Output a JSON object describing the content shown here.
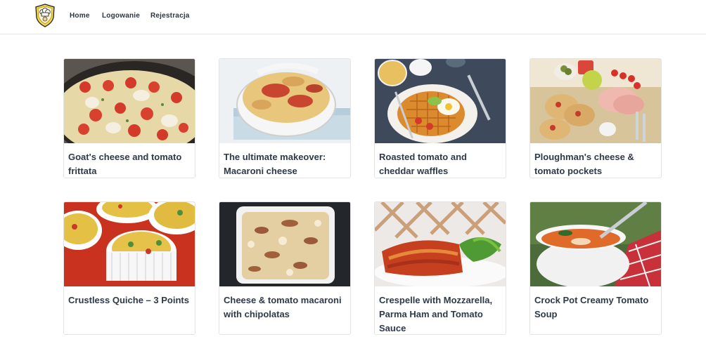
{
  "nav": {
    "logo_icon": "chef-hat-badge-icon",
    "links": [
      "Home",
      "Logowanie",
      "Rejestracja"
    ]
  },
  "recipes": [
    {
      "title": "Goat's cheese and tomato frittata",
      "image": "frittata-photo"
    },
    {
      "title": "The ultimate makeover: Macaroni cheese",
      "image": "macaroni-cheese-photo"
    },
    {
      "title": "Roasted tomato and cheddar waffles",
      "image": "waffles-photo"
    },
    {
      "title": "Ploughman's cheese & tomato pockets",
      "image": "ploughmans-pockets-photo"
    },
    {
      "title": "Crustless Quiche – 3 Points",
      "image": "crustless-quiche-photo"
    },
    {
      "title": "Cheese & tomato macaroni with chipolatas",
      "image": "macaroni-chipolatas-photo"
    },
    {
      "title": "Crespelle with Mozzarella, Parma Ham and Tomato Sauce",
      "image": "crespelle-photo"
    },
    {
      "title": "Crock Pot Creamy Tomato Soup",
      "image": "tomato-soup-photo"
    }
  ]
}
